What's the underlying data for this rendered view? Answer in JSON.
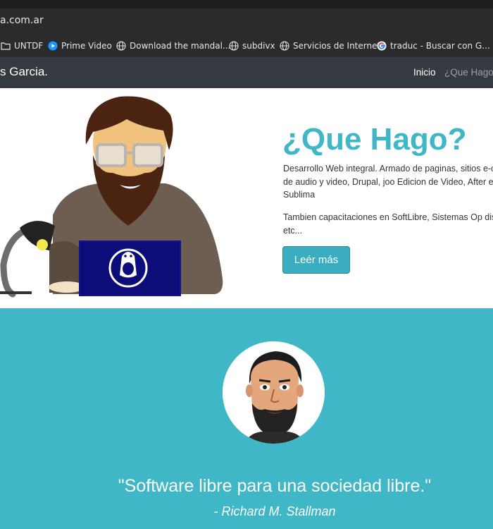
{
  "browser": {
    "url": "a.com.ar",
    "bookmarks": [
      {
        "label": "UNTDF",
        "icon": "folder-icon"
      },
      {
        "label": "Prime Video",
        "icon": "prime-video-icon"
      },
      {
        "label": "Download the mandal...",
        "icon": "globe-icon"
      },
      {
        "label": "subdivx",
        "icon": "globe-icon"
      },
      {
        "label": "Servicios de Internet",
        "icon": "globe-icon"
      },
      {
        "label": "traduc - Buscar con G...",
        "icon": "google-icon"
      }
    ]
  },
  "navbar": {
    "brand": "s Garcia.",
    "links": [
      "Inicio",
      "¿Que Hago?"
    ]
  },
  "hero": {
    "title": "¿Que Hago?",
    "paragraph1": "Desarrollo Web integral. Armado de paginas, sitios e-comerce, streaming de audio y video, Drupal, joo Edicion de Video, After efects, Carteleria y Sublima",
    "paragraph2": "Tambien capacitaciones en SoftLibre, Sistemas Op diseño digital, edicion, etc...",
    "button": "Leér más"
  },
  "quote_section": {
    "quote": "\"Software libre para una sociedad libre.\"",
    "author": "- Richard M. Stallman"
  },
  "colors": {
    "accent": "#3fb7c7",
    "navbar": "#343a40",
    "browser_chrome": "#2b2b2e"
  }
}
